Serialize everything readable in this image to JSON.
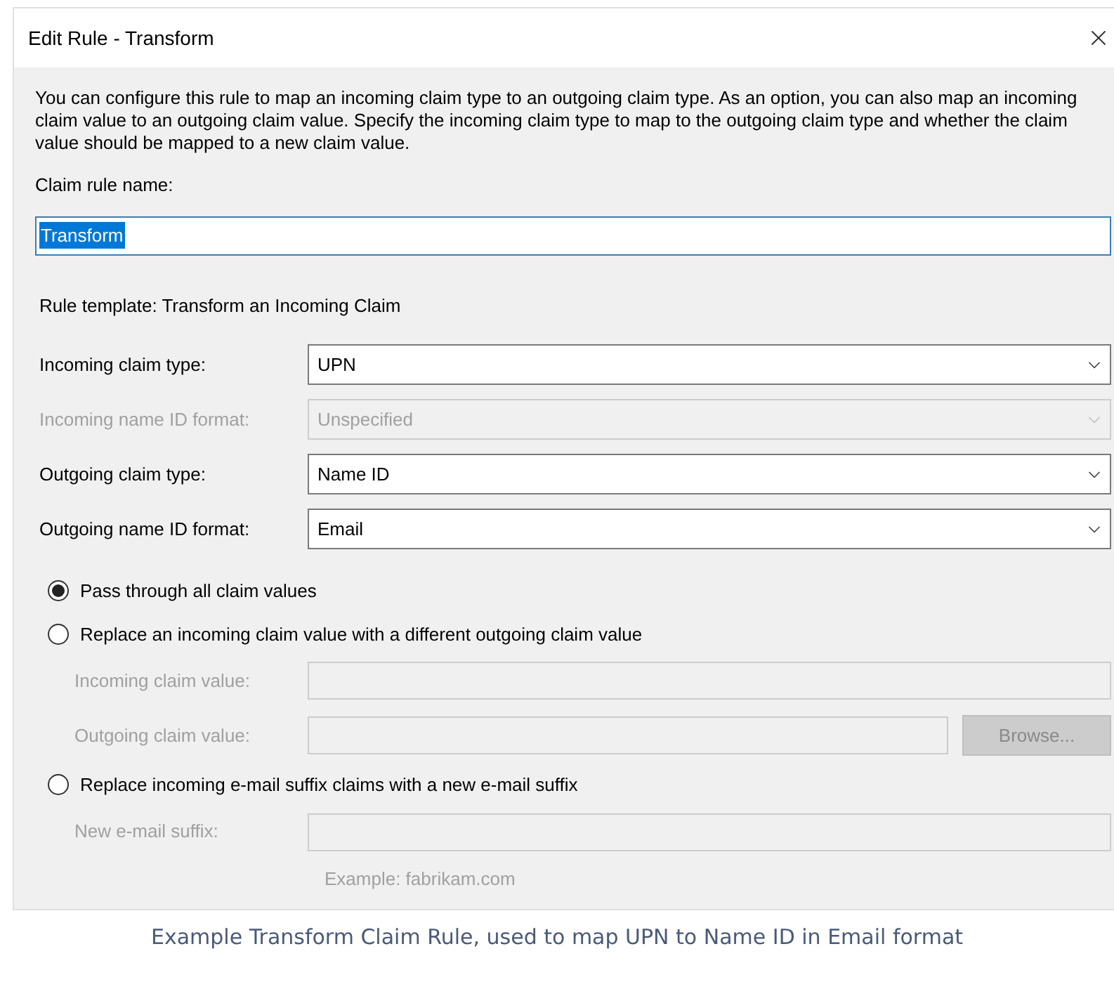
{
  "window": {
    "title": "Edit Rule - Transform"
  },
  "description": "You can configure this rule to map an incoming claim type to an outgoing claim type. As an option, you can also map an incoming claim value to an outgoing claim value. Specify the incoming claim type to map to the outgoing claim type and whether the claim value should be mapped to a new claim value.",
  "rule_name": {
    "label": "Claim rule name:",
    "value": "Transform",
    "selected": true
  },
  "template": "Rule template: Transform an Incoming Claim",
  "dropdowns": [
    {
      "label": "Incoming claim type:",
      "value": "UPN",
      "disabled": false
    },
    {
      "label": "Incoming name ID format:",
      "value": "Unspecified",
      "disabled": true
    },
    {
      "label": "Outgoing claim type:",
      "value": "Name ID",
      "disabled": false
    },
    {
      "label": "Outgoing name ID format:",
      "value": "Email",
      "disabled": false
    }
  ],
  "options": [
    {
      "label": "Pass through all claim values",
      "selected": true
    },
    {
      "label": "Replace an incoming claim value with a different outgoing claim value",
      "selected": false,
      "fields": [
        {
          "label": "Incoming claim value:",
          "disabled": true
        },
        {
          "label": "Outgoing claim value:",
          "disabled": true,
          "button": {
            "label": "Browse...",
            "disabled": true
          }
        }
      ]
    },
    {
      "label": "Replace incoming e-mail suffix claims with a new e-mail suffix",
      "selected": false,
      "fields": [
        {
          "label": "New e-mail suffix:",
          "disabled": true
        }
      ],
      "example": "Example: fabrikam.com"
    }
  ],
  "caption": "Example Transform Claim Rule, used to map UPN to Name ID in Email format"
}
